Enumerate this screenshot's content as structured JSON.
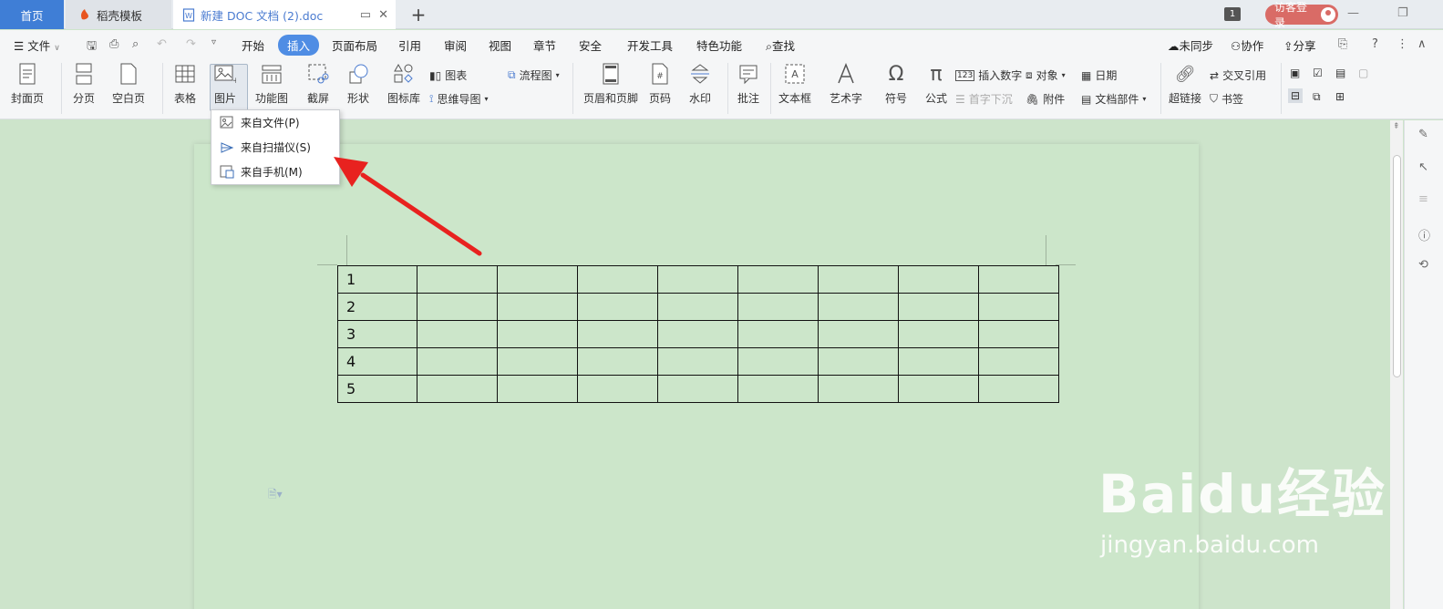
{
  "tabs": {
    "home": "首页",
    "template": "稻壳模板",
    "doc": "新建 DOC 文档 (2).doc",
    "new_tab": "+"
  },
  "titlebar": {
    "window_count": "1",
    "login": "访客登录"
  },
  "menu": {
    "file": "文件",
    "items": [
      "开始",
      "插入",
      "页面布局",
      "引用",
      "审阅",
      "视图",
      "章节",
      "安全",
      "开发工具",
      "特色功能"
    ],
    "active": "插入",
    "search": "查找",
    "sync": "未同步",
    "collab": "协作",
    "share": "分享"
  },
  "ribbon": {
    "cover": "封面页",
    "page_break": "分页",
    "blank_page": "空白页",
    "table": "表格",
    "picture": "图片",
    "function_chart": "功能图",
    "screenshot": "截屏",
    "shapes": "形状",
    "icon_library": "图标库",
    "chart": "图表",
    "mindmap": "思维导图",
    "flowchart": "流程图",
    "header_footer": "页眉和页脚",
    "page_number": "页码",
    "watermark": "水印",
    "comment": "批注",
    "textbox": "文本框",
    "wordart": "艺术字",
    "symbol": "符号",
    "formula": "公式",
    "insert_number": "插入数字",
    "object": "对象",
    "date": "日期",
    "drop_cap": "首字下沉",
    "attachment": "附件",
    "doc_parts": "文档部件",
    "hyperlink": "超链接",
    "cross_ref": "交叉引用",
    "bookmark": "书签"
  },
  "picture_menu": {
    "items": [
      "来自文件(P)",
      "来自扫描仪(S)",
      "来自手机(M)"
    ]
  },
  "table": {
    "rows": [
      [
        "1",
        "",
        "",
        "",
        "",
        "",
        "",
        "",
        ""
      ],
      [
        "2",
        "",
        "",
        "",
        "",
        "",
        "",
        "",
        ""
      ],
      [
        "3",
        "",
        "",
        "",
        "",
        "",
        "",
        "",
        ""
      ],
      [
        "4",
        "",
        "",
        "",
        "",
        "",
        "",
        "",
        ""
      ],
      [
        "5",
        "",
        "",
        "",
        "",
        "",
        "",
        "",
        ""
      ]
    ]
  },
  "watermark": {
    "brand": "Baidu经验",
    "url": "jingyan.baidu.com"
  },
  "colors": {
    "tab_active": "#3f7ed6",
    "menu_active": "#4f8de4",
    "doc_background": "#cde4cb",
    "arrow": "#e8221f",
    "login_button": "#d96b66"
  }
}
